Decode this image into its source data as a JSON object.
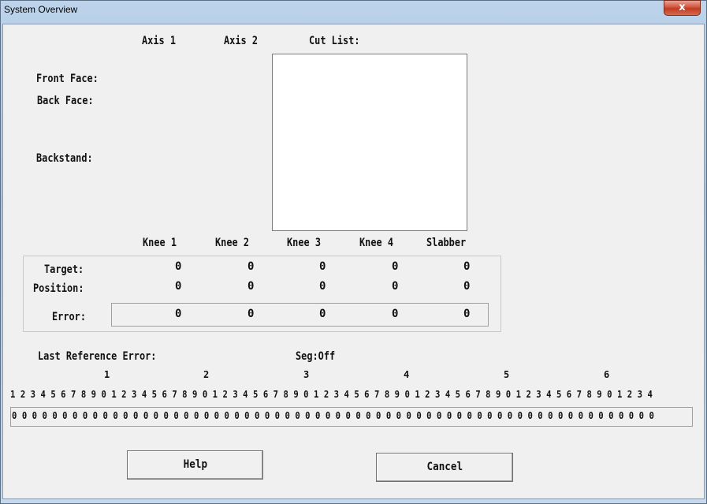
{
  "window": {
    "title": "System Overview",
    "close_glyph": "x"
  },
  "header": {
    "axis1": "Axis 1",
    "axis2": "Axis 2",
    "cut_list": "Cut List:"
  },
  "rows": {
    "front_face": "Front Face:",
    "back_face": "Back Face:",
    "backstand": "Backstand:"
  },
  "knees": {
    "columns": [
      "Knee 1",
      "Knee 2",
      "Knee 3",
      "Knee 4",
      "Slabber"
    ],
    "target_label": "Target:",
    "position_label": "Position:",
    "error_label": "Error:",
    "target": [
      "0",
      "0",
      "0",
      "0",
      "0"
    ],
    "position": [
      "0",
      "0",
      "0",
      "0",
      "0"
    ],
    "error": [
      "0",
      "0",
      "0",
      "0",
      "0"
    ]
  },
  "reference": {
    "last_error_label": "Last Reference Error:",
    "seg_status": "Seg:Off"
  },
  "bits": {
    "tens": [
      "1",
      "2",
      "3",
      "4",
      "5",
      "6"
    ],
    "index_row": "1 2 3 4 5 6 7 8 9 0 1 2 3 4 5 6 7 8 9 0 1 2 3 4 5 6 7 8 9 0 1 2 3 4 5 6 7 8 9 0 1 2 3 4 5 6 7 8 9 0 1 2 3 4 5 6 7 8 9 0 1 2 3 4",
    "values": "0 0 0 0 0 0 0 0 0 0 0 0 0 0 0 0 0 0 0 0 0 0 0 0 0 0 0 0 0 0 0 0 0 0 0 0 0 0 0 0 0 0 0 0 0 0 0 0 0 0 0 0 0 0 0 0 0 0 0 0 0 0 0 0"
  },
  "buttons": {
    "help": "Help",
    "cancel": "Cancel"
  }
}
